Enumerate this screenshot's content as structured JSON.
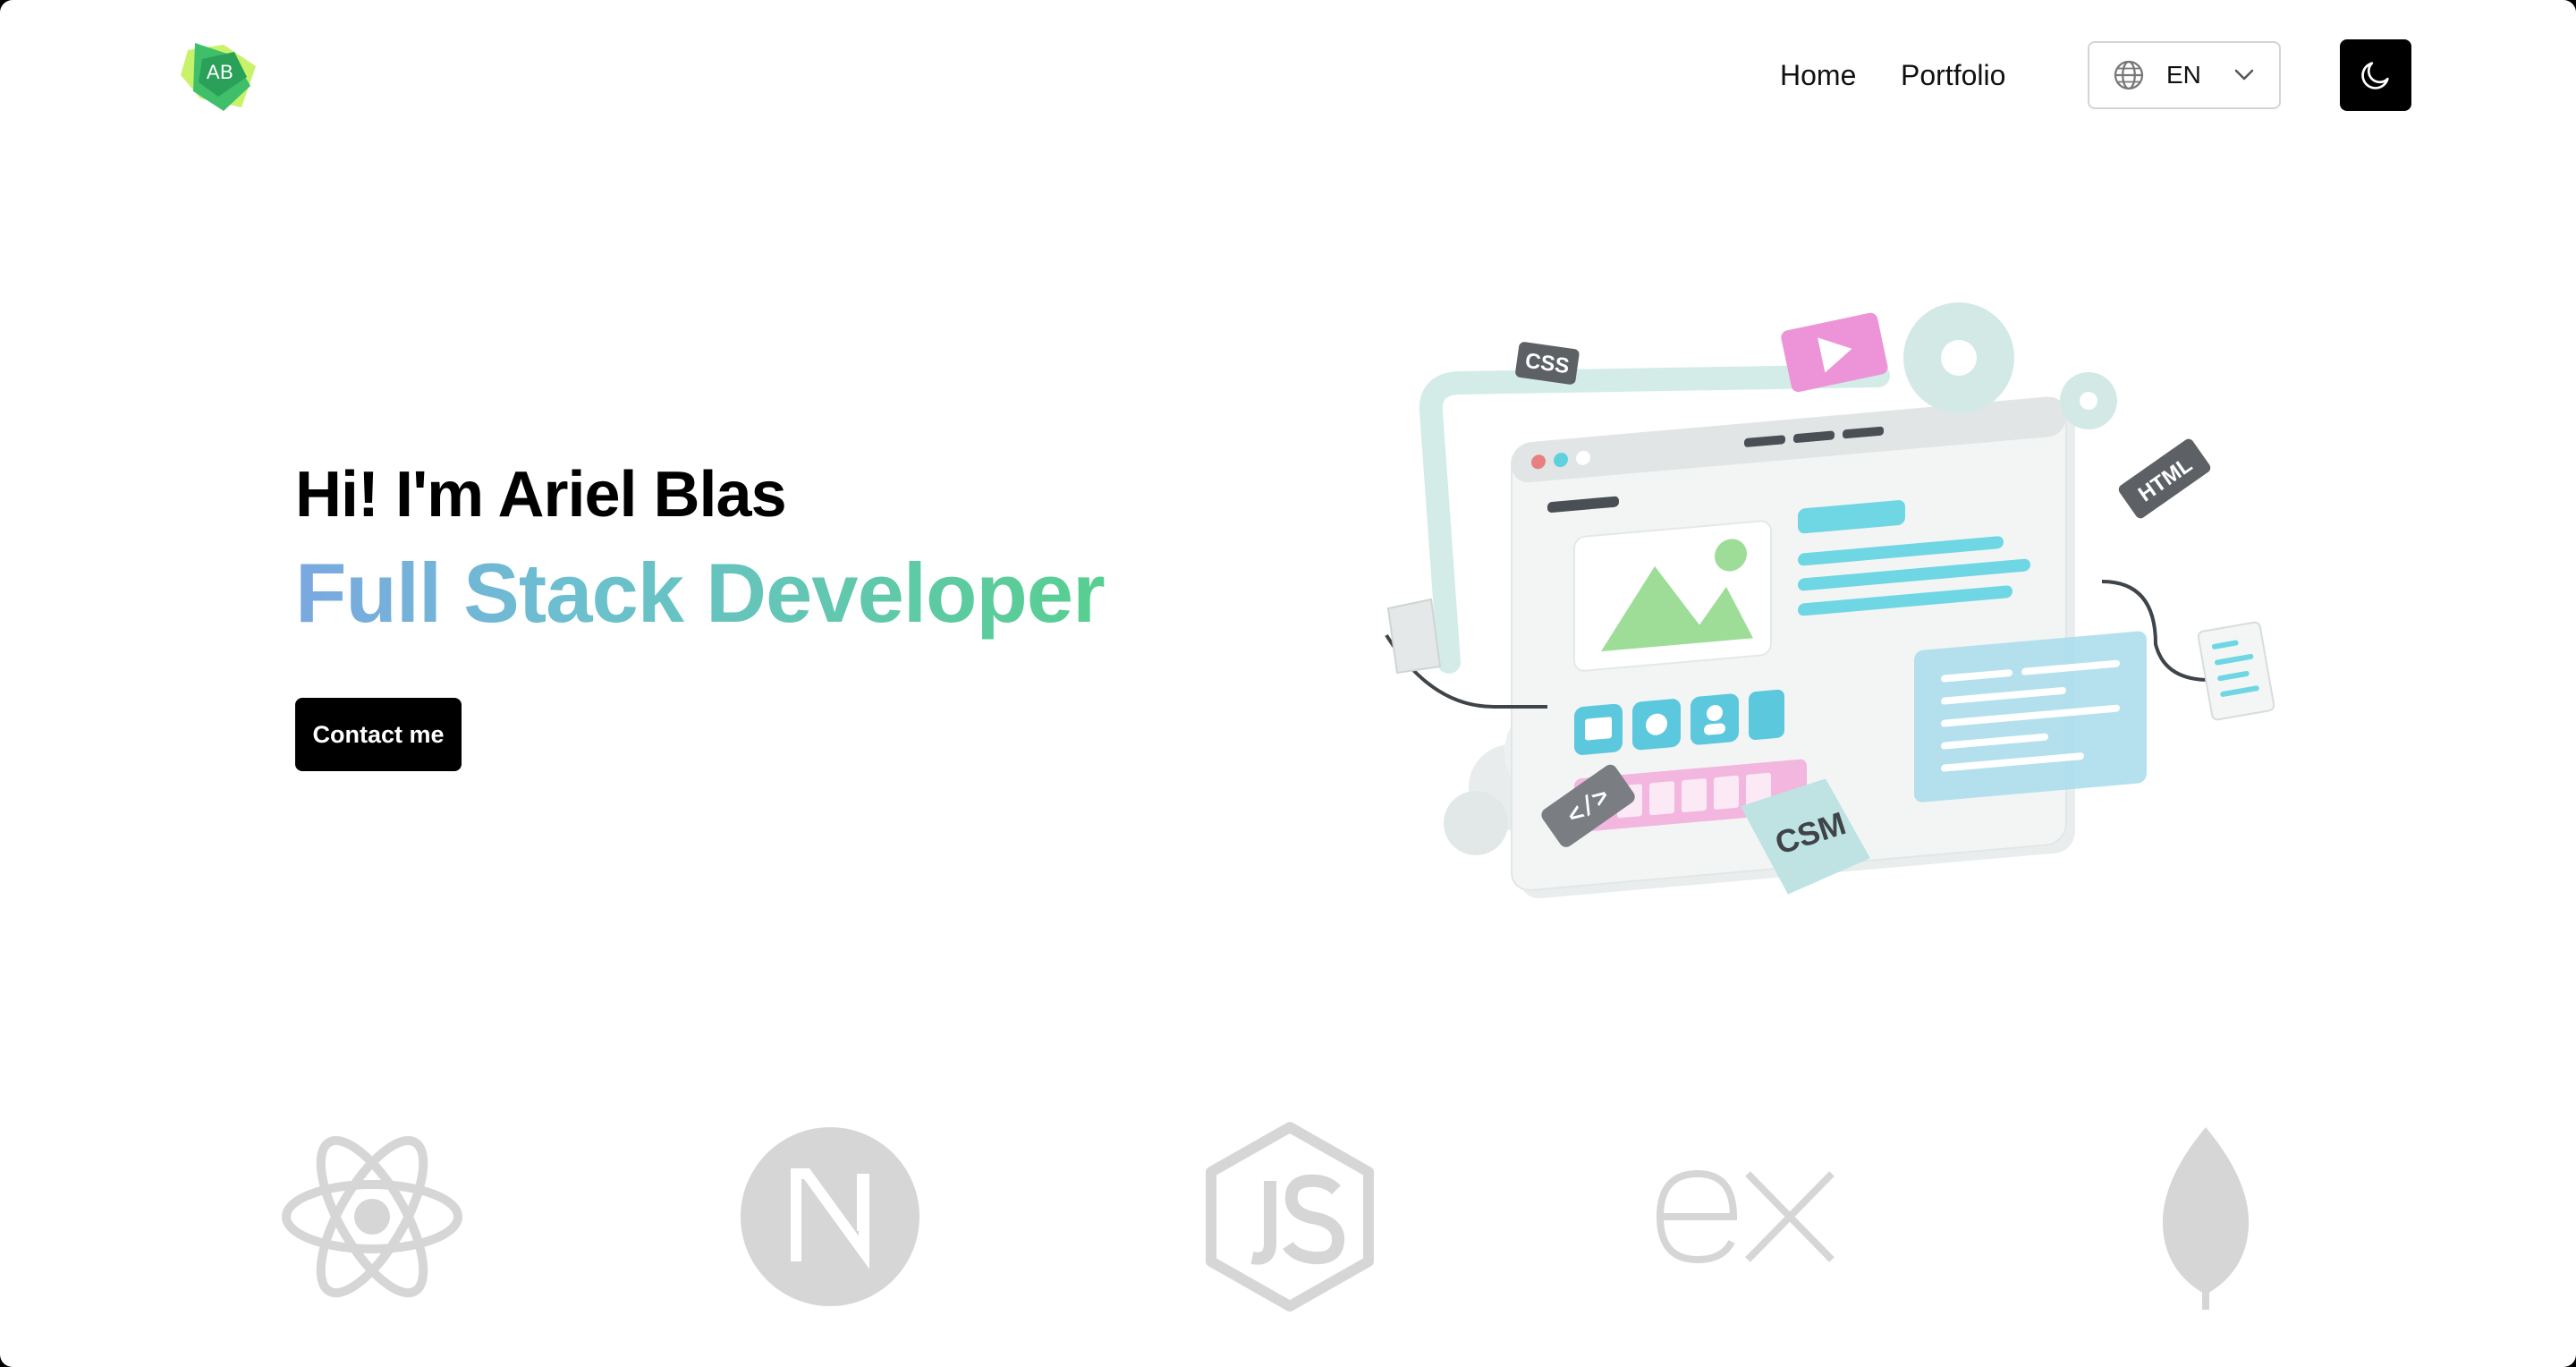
{
  "header": {
    "logo_text": "AB",
    "nav": [
      {
        "label": "Home"
      },
      {
        "label": "Portfolio"
      }
    ],
    "language": {
      "selected": "EN"
    }
  },
  "hero": {
    "greeting": "Hi! I'm Ariel Blas",
    "role": "Full Stack Developer",
    "cta_label": "Contact me",
    "illustration_labels": {
      "css": "CSS",
      "html": "HTML",
      "csm": "CSM",
      "code": "</>"
    }
  },
  "tech_icons": [
    "react-icon",
    "nextjs-icon",
    "nodejs-icon",
    "express-icon",
    "mongodb-icon"
  ],
  "colors": {
    "gradient_start": "#7aa8e0",
    "gradient_end": "#57cf8f",
    "logo_green": "#3fbf6a",
    "tech_grey": "#d6d6d6"
  }
}
